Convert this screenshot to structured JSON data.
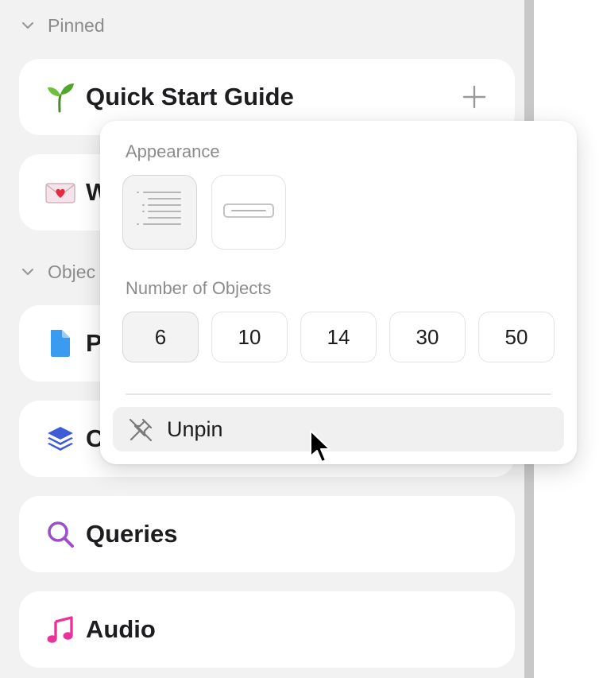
{
  "sidebar": {
    "pinned_header": {
      "label": "Pinned",
      "icon": "chevron-down-icon"
    },
    "objects_header": {
      "label": "Objec",
      "icon": "chevron-down-icon"
    },
    "cards": [
      {
        "title": "Quick Start Guide",
        "icon": "seedling-icon",
        "emoji": "🌱"
      },
      {
        "title": "W",
        "icon": "love-letter-icon",
        "emoji": "💌"
      },
      {
        "title": "P",
        "icon": "page-icon",
        "color": "#3a9bf0"
      },
      {
        "title": "C",
        "icon": "layers-icon",
        "color": "#3f5bd8"
      },
      {
        "title": "Queries",
        "icon": "search-icon",
        "color": "#9b4fc9"
      },
      {
        "title": "Audio",
        "icon": "music-note-icon",
        "color": "#e8339a"
      }
    ]
  },
  "popover": {
    "appearance_label": "Appearance",
    "appearance_options": [
      {
        "name": "list",
        "icon": "list-view-icon",
        "selected": true
      },
      {
        "name": "compact",
        "icon": "compact-view-icon",
        "selected": false
      }
    ],
    "count_label": "Number of Objects",
    "count_options": [
      {
        "value": "6",
        "selected": true
      },
      {
        "value": "10",
        "selected": false
      },
      {
        "value": "14",
        "selected": false
      },
      {
        "value": "30",
        "selected": false
      },
      {
        "value": "50",
        "selected": false
      }
    ],
    "unpin_label": "Unpin",
    "unpin_icon": "pin-off-icon"
  }
}
